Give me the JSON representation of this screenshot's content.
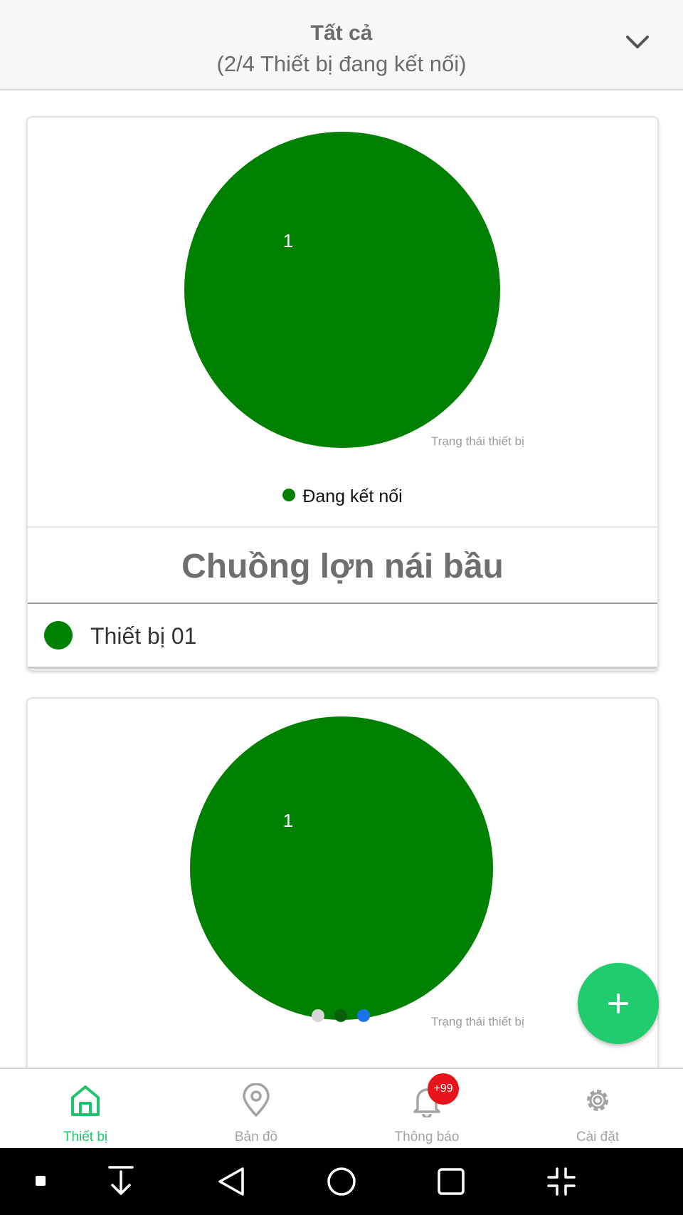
{
  "header": {
    "title": "Tất cả",
    "subtitle": "(2/4 Thiết bị đang kết nối)"
  },
  "cards": [
    {
      "pie_value_label": "1",
      "chart_caption": "Trạng thái thiết bị",
      "legend_label": "Đang kết nối",
      "title": "Chuồng lợn nái bầu",
      "devices": [
        {
          "name": "Thiết bị 01",
          "status_color": "#008000"
        }
      ]
    },
    {
      "pie_value_label": "1",
      "chart_caption": "Trạng thái thiết bị",
      "pager_dots": 3,
      "pager_active_index": 2
    }
  ],
  "chart_data": [
    {
      "type": "pie",
      "title": "Trạng thái thiết bị",
      "categories": [
        "Đang kết nối"
      ],
      "values": [
        1
      ],
      "colors": [
        "#008000"
      ],
      "legend": "bottom"
    },
    {
      "type": "pie",
      "title": "Trạng thái thiết bị",
      "categories": [
        "Đang kết nối"
      ],
      "values": [
        1
      ],
      "colors": [
        "#008000"
      ]
    }
  ],
  "fab": {
    "icon": "plus-icon",
    "color": "#21cc6f"
  },
  "tabs": [
    {
      "label": "Thiết bị",
      "icon": "home-icon",
      "active": true
    },
    {
      "label": "Bản đồ",
      "icon": "map-pin-icon",
      "active": false
    },
    {
      "label": "Thông báo",
      "icon": "bell-icon",
      "active": false,
      "badge": "+99"
    },
    {
      "label": "Cài đặt",
      "icon": "gear-icon",
      "active": false
    }
  ],
  "colors": {
    "accent": "#21cc6f",
    "connected": "#008000",
    "badge": "#e8141c",
    "pager_active": "#1a73e8"
  },
  "system_nav": [
    "stop-icon",
    "download-icon",
    "back-icon",
    "home-circle-icon",
    "recents-icon",
    "collapse-icon"
  ]
}
